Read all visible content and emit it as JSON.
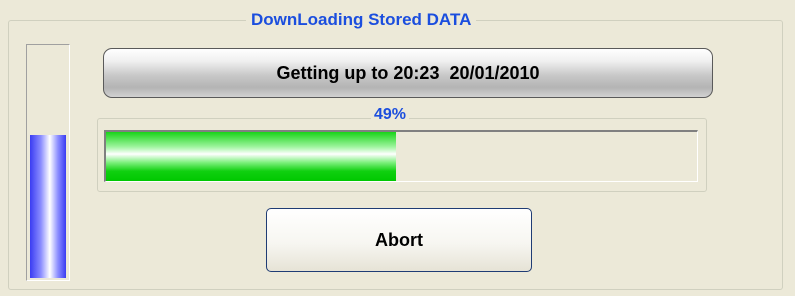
{
  "dialog": {
    "group_title": "DownLoading Stored DATA",
    "status_message": "Getting up to 20:23  20/01/2010",
    "progress": {
      "percent": 49,
      "label": "49%",
      "fill_color": "#10d010"
    },
    "level_meter": {
      "fraction": 0.61,
      "fill_color": "#3a3cf2"
    },
    "abort_label": "Abort"
  },
  "colors": {
    "background": "#ece9d8",
    "title_text": "#1b4ede",
    "button_border": "#1f3c74"
  }
}
